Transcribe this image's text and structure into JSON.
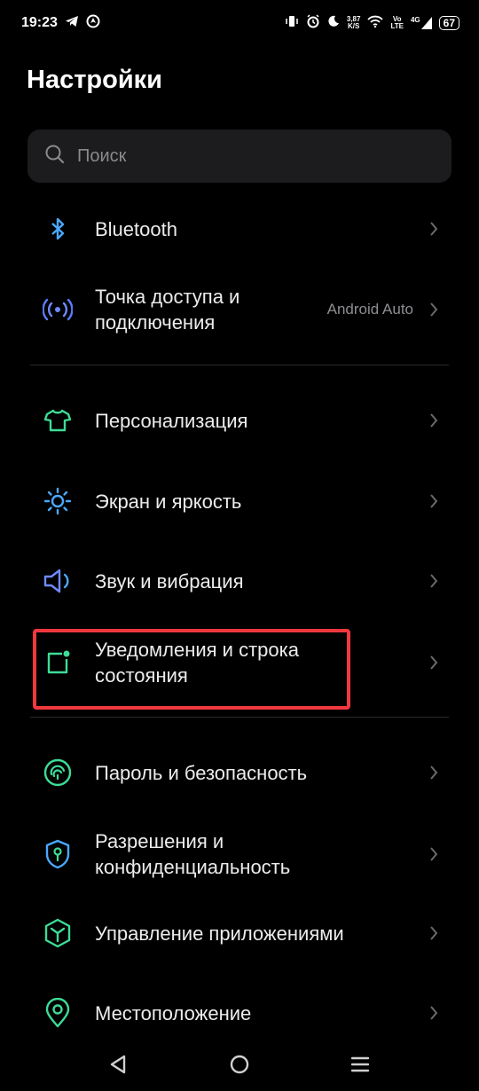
{
  "status_bar": {
    "time": "19:23",
    "speed_value": "3,87",
    "speed_unit": "K/S",
    "volte_top": "Vo",
    "volte_bottom": "LTE",
    "network": "4G",
    "battery": "67"
  },
  "header": {
    "title": "Настройки"
  },
  "search": {
    "placeholder": "Поиск"
  },
  "settings": [
    {
      "id": "bluetooth",
      "label": "Bluetooth",
      "icon": "bluetooth-icon",
      "color": "#4aa8ff"
    },
    {
      "id": "hotspot",
      "label_line1": "Точка доступа и",
      "label_line2": "подключения",
      "value": "Android Auto",
      "icon": "hotspot-icon",
      "color": "#6e8bff"
    },
    {
      "id": "personalization",
      "label": "Персонализация",
      "icon": "tshirt-icon",
      "color": "#3ddc97"
    },
    {
      "id": "display",
      "label": "Экран и яркость",
      "icon": "sun-icon",
      "color": "#4aa8ff"
    },
    {
      "id": "sound",
      "label": "Звук и вибрация",
      "icon": "speaker-icon",
      "color": "#6e8bff"
    },
    {
      "id": "notifications",
      "label_line1": "Уведомления и строка",
      "label_line2": "состояния",
      "icon": "notification-icon",
      "color": "#3ddc97"
    },
    {
      "id": "security",
      "label": "Пароль и безопасность",
      "icon": "fingerprint-icon",
      "color": "#3ddc97"
    },
    {
      "id": "privacy",
      "label_line1": "Разрешения и",
      "label_line2": "конфиденциальность",
      "icon": "shield-lock-icon",
      "color": "#4aa8ff"
    },
    {
      "id": "apps",
      "label": "Управление приложениями",
      "icon": "cube-icon",
      "color": "#3ddc97"
    },
    {
      "id": "location",
      "label": "Местоположение",
      "icon": "location-pin-icon",
      "color": "#3ddc97"
    }
  ],
  "highlight_color": "#f0383e"
}
